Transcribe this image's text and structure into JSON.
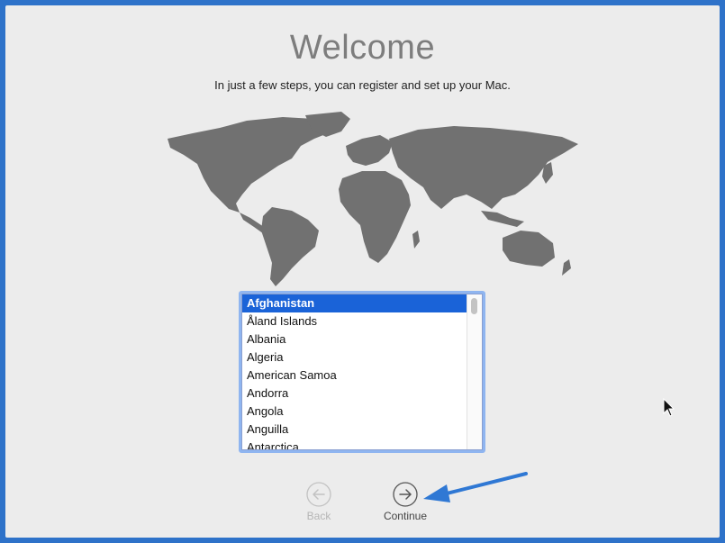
{
  "header": {
    "title": "Welcome",
    "subtitle": "In just a few steps, you can register and set up your Mac."
  },
  "country_list": {
    "selected_index": 0,
    "items": [
      "Afghanistan",
      "Åland Islands",
      "Albania",
      "Algeria",
      "American Samoa",
      "Andorra",
      "Angola",
      "Anguilla",
      "Antarctica"
    ]
  },
  "navigation": {
    "back_label": "Back",
    "continue_label": "Continue"
  },
  "colors": {
    "desktop_blue": "#2e72c9",
    "selection_blue": "#1a63d8",
    "map_gray": "#717171",
    "annotation_arrow": "#2f78d4"
  },
  "icons": {
    "back": "left-arrow-circle-icon",
    "continue": "right-arrow-circle-icon",
    "annotation": "pointer-arrow-icon",
    "cursor": "mouse-cursor-icon"
  }
}
